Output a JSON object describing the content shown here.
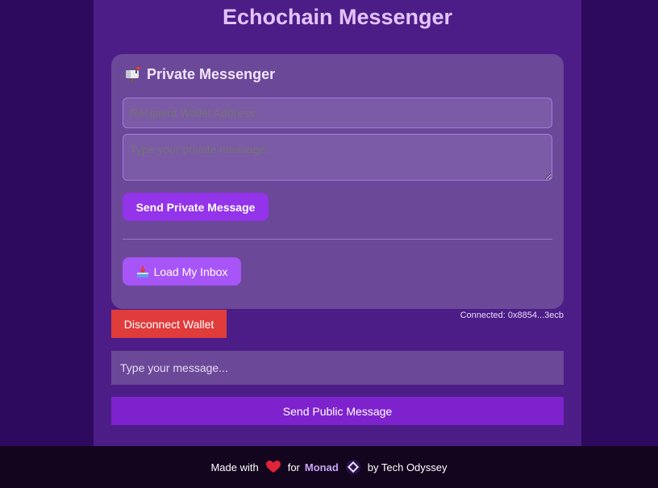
{
  "app": {
    "title": "Echochain Messenger"
  },
  "private_card": {
    "title": "Private Messenger",
    "title_icon": "mailbox-icon",
    "recipient_placeholder": "Recipient Wallet Address",
    "message_placeholder": "Type your private message...",
    "send_label": "Send Private Message",
    "inbox_label": "Load My Inbox",
    "inbox_icon": "inbox-tray-icon"
  },
  "wallet": {
    "disconnect_label": "Disconnect Wallet",
    "connected_text": "Connected: 0x8854...3ecb"
  },
  "public": {
    "message_placeholder": "Type your message...",
    "send_label": "Send Public Message"
  },
  "footer": {
    "made_with": "Made with",
    "for_text": "for",
    "brand": "Monad",
    "by_text": "by Tech Odyssey"
  },
  "colors": {
    "page_bg": "#2e0a5e",
    "column_bg": "#4c1d86",
    "card_bg": "#6b4898",
    "accent_purple": "#9333ea",
    "danger_red": "#e03c3c",
    "title_lilac": "#e3c4ff"
  }
}
